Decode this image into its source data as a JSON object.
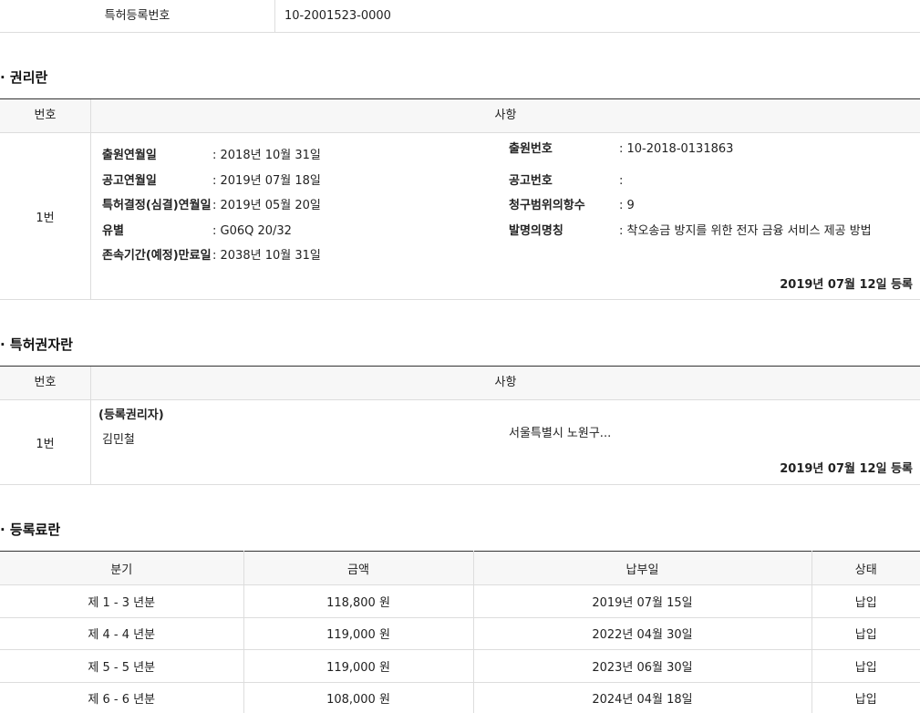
{
  "top": {
    "label": "특허등록번호",
    "value": "10-2001523-0000"
  },
  "rights": {
    "title": "· 권리란",
    "header_num": "번호",
    "header_item": "사항",
    "row_num": "1번",
    "left": [
      {
        "key": "출원연월일",
        "value": ": 2018년 10월 31일"
      },
      {
        "key": "공고연월일",
        "value": ": 2019년 07월 18일"
      },
      {
        "key": "특허결정(심결)연월일",
        "value": ": 2019년 05월 20일"
      },
      {
        "key": "유별",
        "value": ": G06Q 20/32"
      },
      {
        "key": "존속기간(예정)만료일",
        "value": ": 2038년 10월 31일"
      }
    ],
    "right": [
      {
        "key": "출원번호",
        "value": ": 10-2018-0131863"
      },
      {
        "key": "공고번호",
        "value": ":"
      },
      {
        "key": "청구범위의항수",
        "value": ": 9"
      },
      {
        "key": "발명의명칭",
        "value": ": 착오송금 방지를 위한 전자 금융 서비스 제공 방법"
      }
    ],
    "reg_date": "2019년 07월 12일 등록"
  },
  "holder": {
    "title": "· 특허권자란",
    "header_num": "번호",
    "header_item": "사항",
    "row_num": "1번",
    "role": "(등록권리자)",
    "name": "김민철",
    "address": "서울특별시 노원구...",
    "reg_date": "2019년 07월 12일 등록"
  },
  "fees": {
    "title": "· 등록료란",
    "headers": [
      "분기",
      "금액",
      "납부일",
      "상태"
    ],
    "rows": [
      [
        "제 1 - 3 년분",
        "118,800 원",
        "2019년 07월 15일",
        "납입"
      ],
      [
        "제 4 - 4 년분",
        "119,000 원",
        "2022년 04월 30일",
        "납입"
      ],
      [
        "제 5 - 5 년분",
        "119,000 원",
        "2023년 06월 30일",
        "납입"
      ],
      [
        "제 6 - 6 년분",
        "108,000 원",
        "2024년 04월 18일",
        "납입"
      ]
    ]
  }
}
